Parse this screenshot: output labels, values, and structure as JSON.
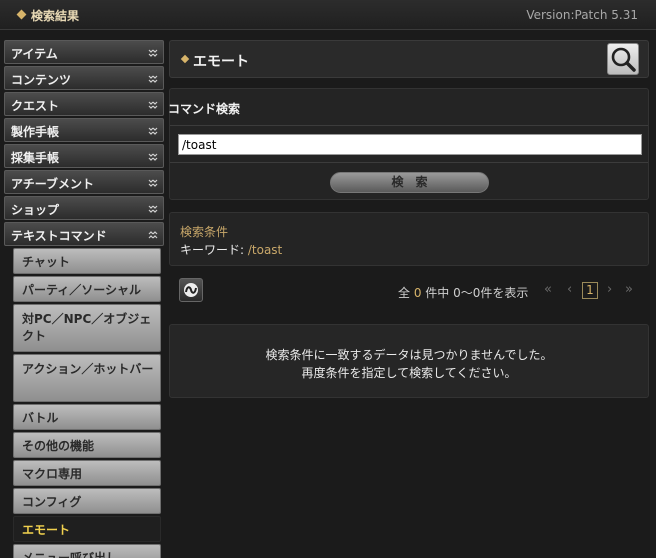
{
  "topbar": {
    "title": "検索結果",
    "version": "Version:Patch 5.31"
  },
  "sidebar": {
    "categories": [
      {
        "label": "アイテム"
      },
      {
        "label": "コンテンツ"
      },
      {
        "label": "クエスト"
      },
      {
        "label": "製作手帳"
      },
      {
        "label": "採集手帳"
      },
      {
        "label": "アチーブメント"
      },
      {
        "label": "ショップ"
      },
      {
        "label": "テキストコマンド"
      }
    ],
    "subitems": [
      {
        "label": "チャット"
      },
      {
        "label": "パーティ／ソーシャル"
      },
      {
        "label": "対PC／NPC／オブジェクト"
      },
      {
        "label": "アクション／ホットバー"
      },
      {
        "label": "バトル"
      },
      {
        "label": "その他の機能"
      },
      {
        "label": "マクロ専用"
      },
      {
        "label": "コンフィグ"
      },
      {
        "label": "エモート"
      },
      {
        "label": "メニュー呼び出し"
      }
    ]
  },
  "main": {
    "title": "エモート",
    "form": {
      "label": "コマンド検索",
      "query": "/toast",
      "button": "検索"
    },
    "condition": {
      "title": "検索条件",
      "keyword_label": "キーワード: ",
      "keyword_value": "/toast"
    },
    "pager": {
      "prefix": "全 ",
      "total": "0",
      "suffix": " 件中 0〜0件を表示",
      "page": "1",
      "first": "«",
      "prev": "‹",
      "next": "›",
      "last": "»"
    },
    "empty": {
      "line1": "検索条件に一致するデータは見つかりませんでした。",
      "line2": "再度条件を指定して検索してください。"
    }
  },
  "colors": {
    "accent": "#d7b46a",
    "active_text": "#f1d14e"
  }
}
